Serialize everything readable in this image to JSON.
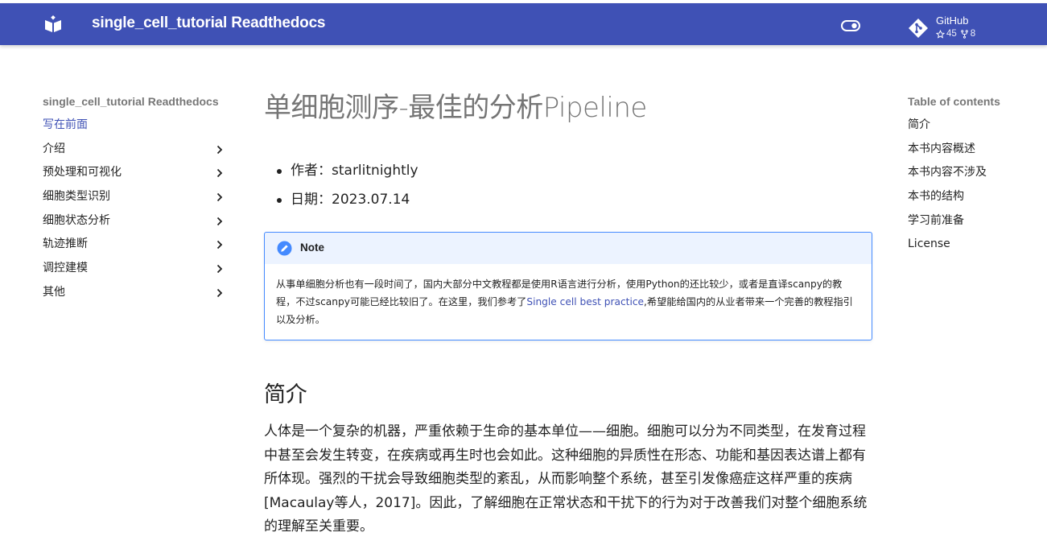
{
  "header": {
    "site_title": "single_cell_tutorial Readthedocs",
    "logo_icon": "book-open-icon",
    "palette_icon": "toggle-switch-icon",
    "repo": {
      "icon": "git-icon",
      "name": "GitHub",
      "stars": "45",
      "forks": "8"
    }
  },
  "nav": {
    "title": "single_cell_tutorial Readthedocs",
    "items": [
      {
        "label": "写在前面",
        "active": true,
        "expandable": false
      },
      {
        "label": "介绍",
        "active": false,
        "expandable": true
      },
      {
        "label": "预处理和可视化",
        "active": false,
        "expandable": true
      },
      {
        "label": "细胞类型识别",
        "active": false,
        "expandable": true
      },
      {
        "label": "细胞状态分析",
        "active": false,
        "expandable": true
      },
      {
        "label": "轨迹推断",
        "active": false,
        "expandable": true
      },
      {
        "label": "调控建模",
        "active": false,
        "expandable": true
      },
      {
        "label": "其他",
        "active": false,
        "expandable": true
      }
    ]
  },
  "toc": {
    "title": "Table of contents",
    "items": [
      "简介",
      "本书内容概述",
      "本书内容不涉及",
      "本书的结构",
      "学习前准备",
      "License"
    ]
  },
  "content": {
    "title": "单细胞测序-最佳的分析Pipeline",
    "meta": [
      "作者：starlitnightly",
      "日期：2023.07.14"
    ],
    "note": {
      "title": "Note",
      "icon": "pencil-icon",
      "text_before": "从事单细胞分析也有一段时间了，国内大部分中文教程都是使用R语言进行分析，使用Python的还比较少，或者是直译scanpy的教程，不过scanpy可能已经比较旧了。在这里，我们参考了",
      "link_text": "Single cell best practice",
      "text_after": ",希望能给国内的从业者带来一个完善的教程指引以及分析。"
    },
    "section_title": "简介",
    "paragraph": "人体是一个复杂的机器，严重依赖于生命的基本单位——细胞。细胞可以分为不同类型，在发育过程中甚至会发生转变，在疾病或再生时也会如此。这种细胞的异质性在形态、功能和基因表达谱上都有所体现。强烈的干扰会导致细胞类型的紊乱，从而影响整个系统，甚至引发像癌症这样严重的疾病[Macaulay等人，2017]。因此，了解细胞在正常状态和干扰下的行为对于改善我们对整个细胞系统的理解至关重要。"
  },
  "colors": {
    "primary": "#3f51b5",
    "note_accent": "#448aff"
  }
}
